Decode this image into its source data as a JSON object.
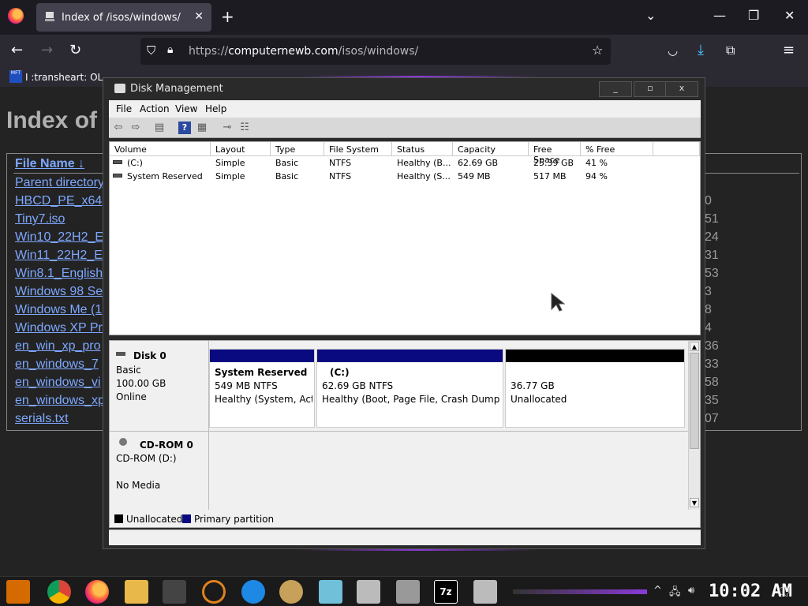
{
  "browser": {
    "tab_title": "Index of /isos/windows/",
    "url_scheme": "https://",
    "url_host": "computernewb.com",
    "url_path": "/isos/windows/",
    "bookmark": "I :transheart: OL",
    "icons": [
      "firefox-icon",
      "tab-favicon-icon",
      "close-icon",
      "plus-icon",
      "chevron-down-icon",
      "minimize-icon",
      "maximize-icon",
      "back-icon",
      "forward-icon",
      "reload-icon",
      "shield-icon",
      "lock-icon",
      "star-icon",
      "pocket-icon",
      "download-icon",
      "extensions-icon",
      "menu-icon"
    ]
  },
  "page": {
    "heading": "Index of",
    "header_col": "File Name  ↓",
    "files": [
      "Parent directory",
      "HBCD_PE_x64",
      "Tiny7.iso",
      "Win10_22H2_E",
      "Win11_22H2_E",
      "Win8.1_English",
      "Windows 98 Se",
      "Windows Me (1",
      "Windows XP Pr",
      "en_win_xp_pro",
      "en_windows_7",
      "en_windows_vi",
      "en_windows_xp",
      "serials.txt"
    ],
    "sizes_partial": [
      "0",
      "51",
      "24",
      "31",
      "53",
      "3",
      "8",
      "4",
      "36",
      "33",
      "58",
      "35",
      "07"
    ]
  },
  "diskmgmt": {
    "title": "Disk Management",
    "window_buttons": [
      "_",
      "▫",
      "x"
    ],
    "menu": [
      "File",
      "Action",
      "View",
      "Help"
    ],
    "columns": [
      "Volume",
      "Layout",
      "Type",
      "File System",
      "Status",
      "Capacity",
      "Free Space",
      "% Free"
    ],
    "volumes": [
      {
        "volume": "(C:)",
        "layout": "Simple",
        "type": "Basic",
        "fs": "NTFS",
        "status": "Healthy (B...",
        "capacity": "62.69 GB",
        "free": "25.39 GB",
        "pct": "41 %"
      },
      {
        "volume": "System Reserved",
        "layout": "Simple",
        "type": "Basic",
        "fs": "NTFS",
        "status": "Healthy (S...",
        "capacity": "549 MB",
        "free": "517 MB",
        "pct": "94 %"
      }
    ],
    "disk0": {
      "name": "Disk 0",
      "type": "Basic",
      "size": "100.00 GB",
      "state": "Online",
      "partitions": [
        {
          "name": "System Reserved",
          "size": "549 MB NTFS",
          "status": "Healthy (System, Acti"
        },
        {
          "name": "(C:)",
          "size": "62.69 GB NTFS",
          "status": "Healthy (Boot, Page File, Crash Dump, Pr"
        },
        {
          "name": "",
          "size": "36.77 GB",
          "status": "Unallocated"
        }
      ]
    },
    "cdrom": {
      "name": "CD-ROM 0",
      "drive": "CD-ROM (D:)",
      "media": "No Media"
    },
    "legend": [
      "Unallocated",
      "Primary partition"
    ],
    "colors": {
      "primary": "#0a0a80",
      "unallocated": "#000000"
    }
  },
  "taskbar": {
    "clock": "10:02 AM",
    "apps": [
      "start-icon",
      "chrome-icon",
      "firefox-icon",
      "explorer-icon",
      "tool-icon",
      "search-icon",
      "ie-icon",
      "paint-icon",
      "notepad-icon",
      "calculator-icon",
      "diskmgmt-icon",
      "7zip-icon",
      "drive-icon"
    ],
    "sevenzip_label": "7z"
  }
}
